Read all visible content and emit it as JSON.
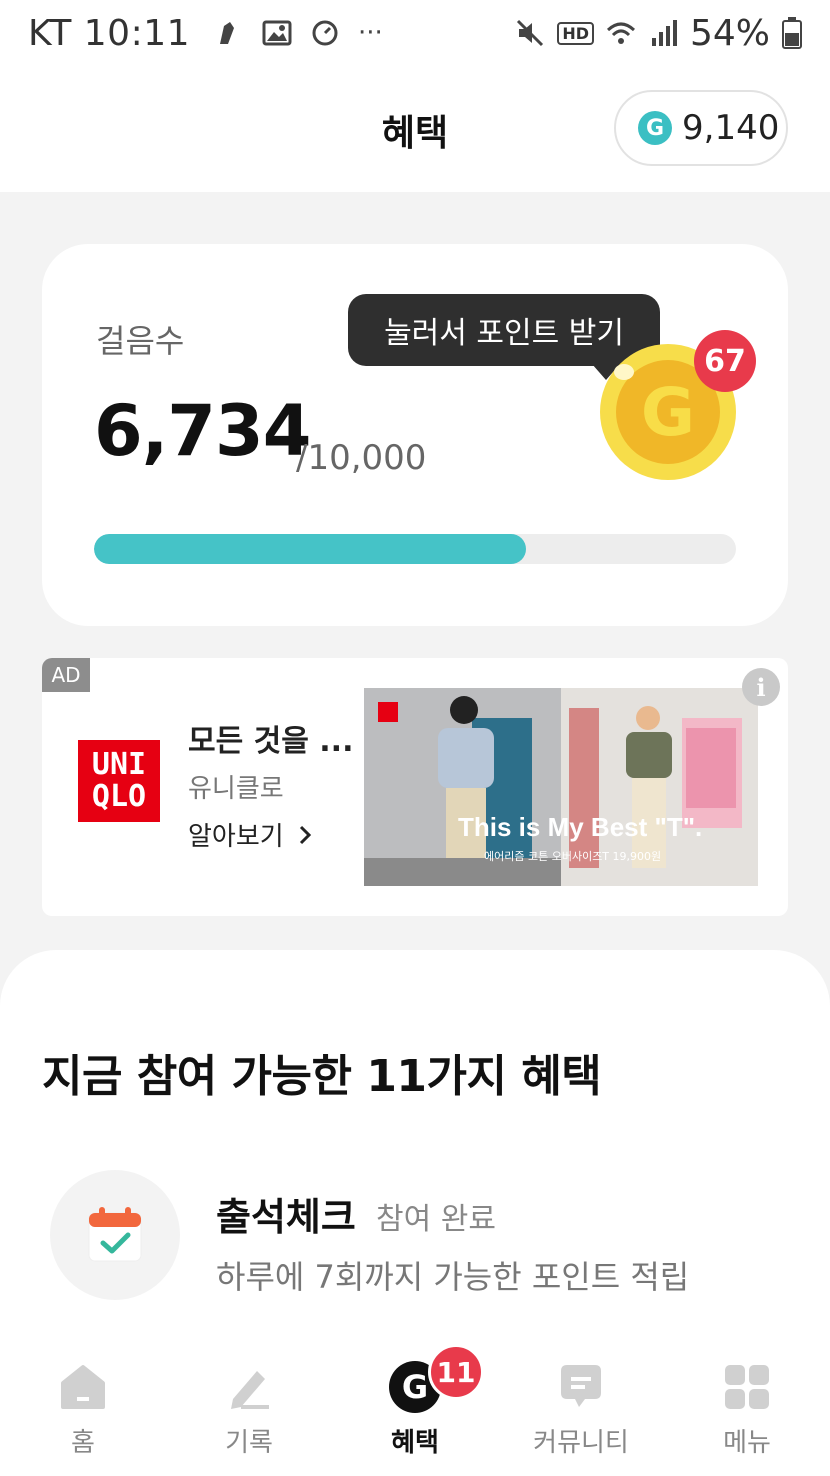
{
  "status_bar": {
    "carrier": "KT",
    "time": "10:11",
    "battery": "54%"
  },
  "header": {
    "title": "혜택",
    "points": "9,140",
    "coin_letter": "G"
  },
  "steps": {
    "label": "걸음수",
    "value": "6,734",
    "goal": "/10,000",
    "progress_fraction": 0.6734,
    "tooltip": "눌러서 포인트 받기",
    "coin_letter": "G",
    "coin_badge": "67"
  },
  "ad": {
    "tag": "AD",
    "logo_line1": "UNI",
    "logo_line2": "QLO",
    "title": "모든 것을 ...",
    "brand": "유니클로",
    "cta": "알아보기",
    "image_text": "This is My Best \"T\".",
    "image_subtext": "에어리즘 코튼 오버사이즈T 19,900원"
  },
  "benefits": {
    "title": "지금 참여 가능한 11가지 혜택",
    "items": [
      {
        "name": "출석체크",
        "status": "참여 완료",
        "description": "하루에 7회까지 가능한 포인트 적립"
      }
    ]
  },
  "nav": {
    "items": [
      {
        "label": "홈",
        "icon": "home-icon"
      },
      {
        "label": "기록",
        "icon": "pencil-icon"
      },
      {
        "label": "혜택",
        "icon": "g-coin-icon",
        "badge": "11",
        "active": true
      },
      {
        "label": "커뮤니티",
        "icon": "chat-icon"
      },
      {
        "label": "메뉴",
        "icon": "grid-icon"
      }
    ]
  },
  "colors": {
    "accent": "#45c3c7",
    "badge": "#e83a4b",
    "coin": "#f0b728"
  }
}
